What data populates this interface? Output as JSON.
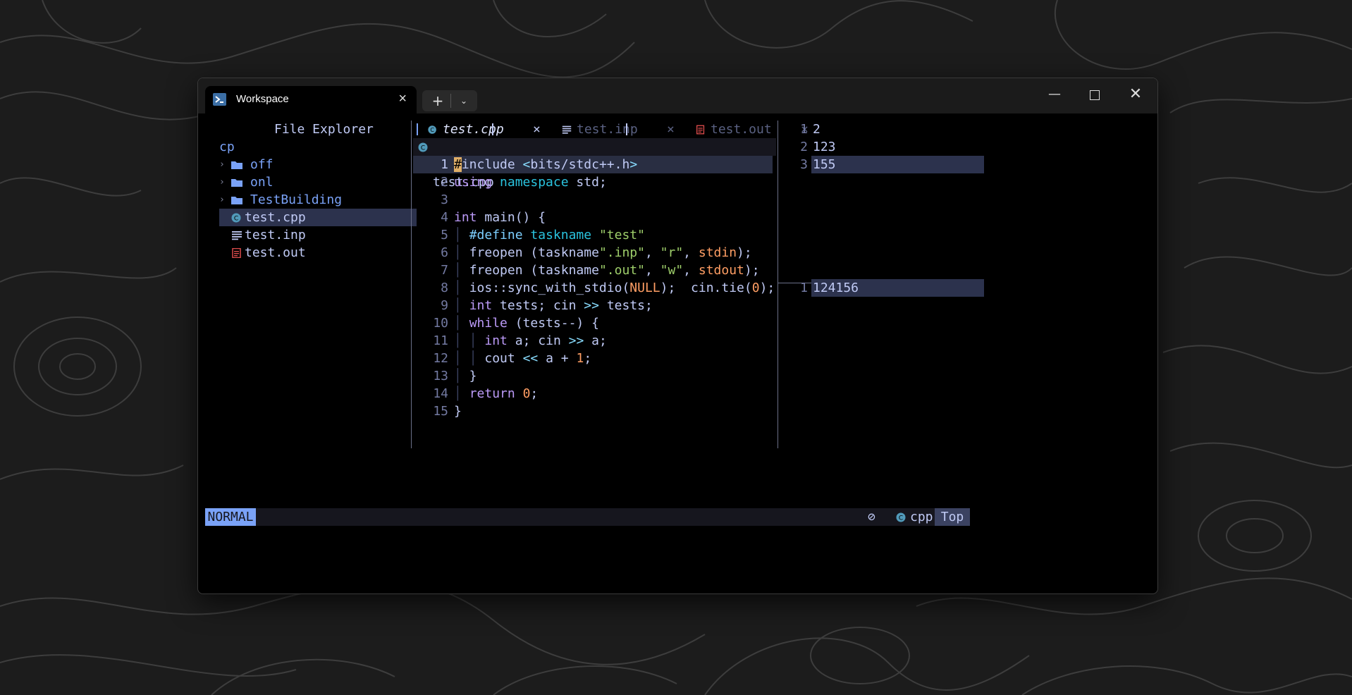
{
  "window": {
    "tab_title": "Workspace",
    "tab_icon": "powershell-icon",
    "close_glyph": "×",
    "new_tab_glyph": "+",
    "dropdown_glyph": "⌄",
    "minimize_glyph": "—",
    "close_window_glyph": "✕"
  },
  "explorer": {
    "title": "File Explorer",
    "root": "cp",
    "items": [
      {
        "type": "folder",
        "chevron": "›",
        "name": "off",
        "icon": "folder-icon"
      },
      {
        "type": "folder",
        "chevron": "›",
        "name": "onl",
        "icon": "folder-icon"
      },
      {
        "type": "folder",
        "chevron": "›",
        "name": "TestBuilding",
        "icon": "folder-icon"
      },
      {
        "type": "file",
        "name": "test.cpp",
        "icon": "cpp-file-icon",
        "selected": true
      },
      {
        "type": "file",
        "name": "test.inp",
        "icon": "text-file-icon"
      },
      {
        "type": "file",
        "name": "test.out",
        "icon": "pdf-file-icon"
      }
    ]
  },
  "buffer_tabs": [
    {
      "name": "test.cpp",
      "close": "×",
      "active": true,
      "icon": "cpp-file-icon"
    },
    {
      "name": "test.inp",
      "close": "×",
      "active": false,
      "icon": "text-file-icon"
    },
    {
      "name": "test.out",
      "close": "×",
      "active": false,
      "icon": "pdf-file-icon"
    }
  ],
  "winbar": {
    "filename": "test.cpp"
  },
  "editor": {
    "cursor_line": 1,
    "lines": [
      "#include <bits/stdc++.h>",
      "using namespace std;",
      "",
      "int main() {",
      "  #define taskname \"test\"",
      "  freopen (taskname\".inp\", \"r\", stdin);",
      "  freopen (taskname\".out\", \"w\", stdout);",
      "  ios::sync_with_stdio(NULL);  cin.tie(0);",
      "  int tests; cin >> tests;",
      "  while (tests--) {",
      "    int a; cin >> a;",
      "    cout << a + 1;",
      "  }",
      "  return 0;",
      "}"
    ]
  },
  "input_pane": {
    "lines": [
      "2",
      "123",
      "155"
    ],
    "highlighted_line": 3
  },
  "output_pane": {
    "lines": [
      "124156"
    ],
    "highlighted_line": 1
  },
  "statusbar": {
    "mode": "NORMAL",
    "no_icon": "⊘",
    "filetype": "cpp",
    "position": "Top"
  },
  "colors": {
    "mode_bg": "#7aa2f7",
    "keyword": "#bb9af7",
    "type": "#2ac3de",
    "string": "#9ece6a",
    "number": "#ff9e64",
    "selection": "#2c324d"
  }
}
